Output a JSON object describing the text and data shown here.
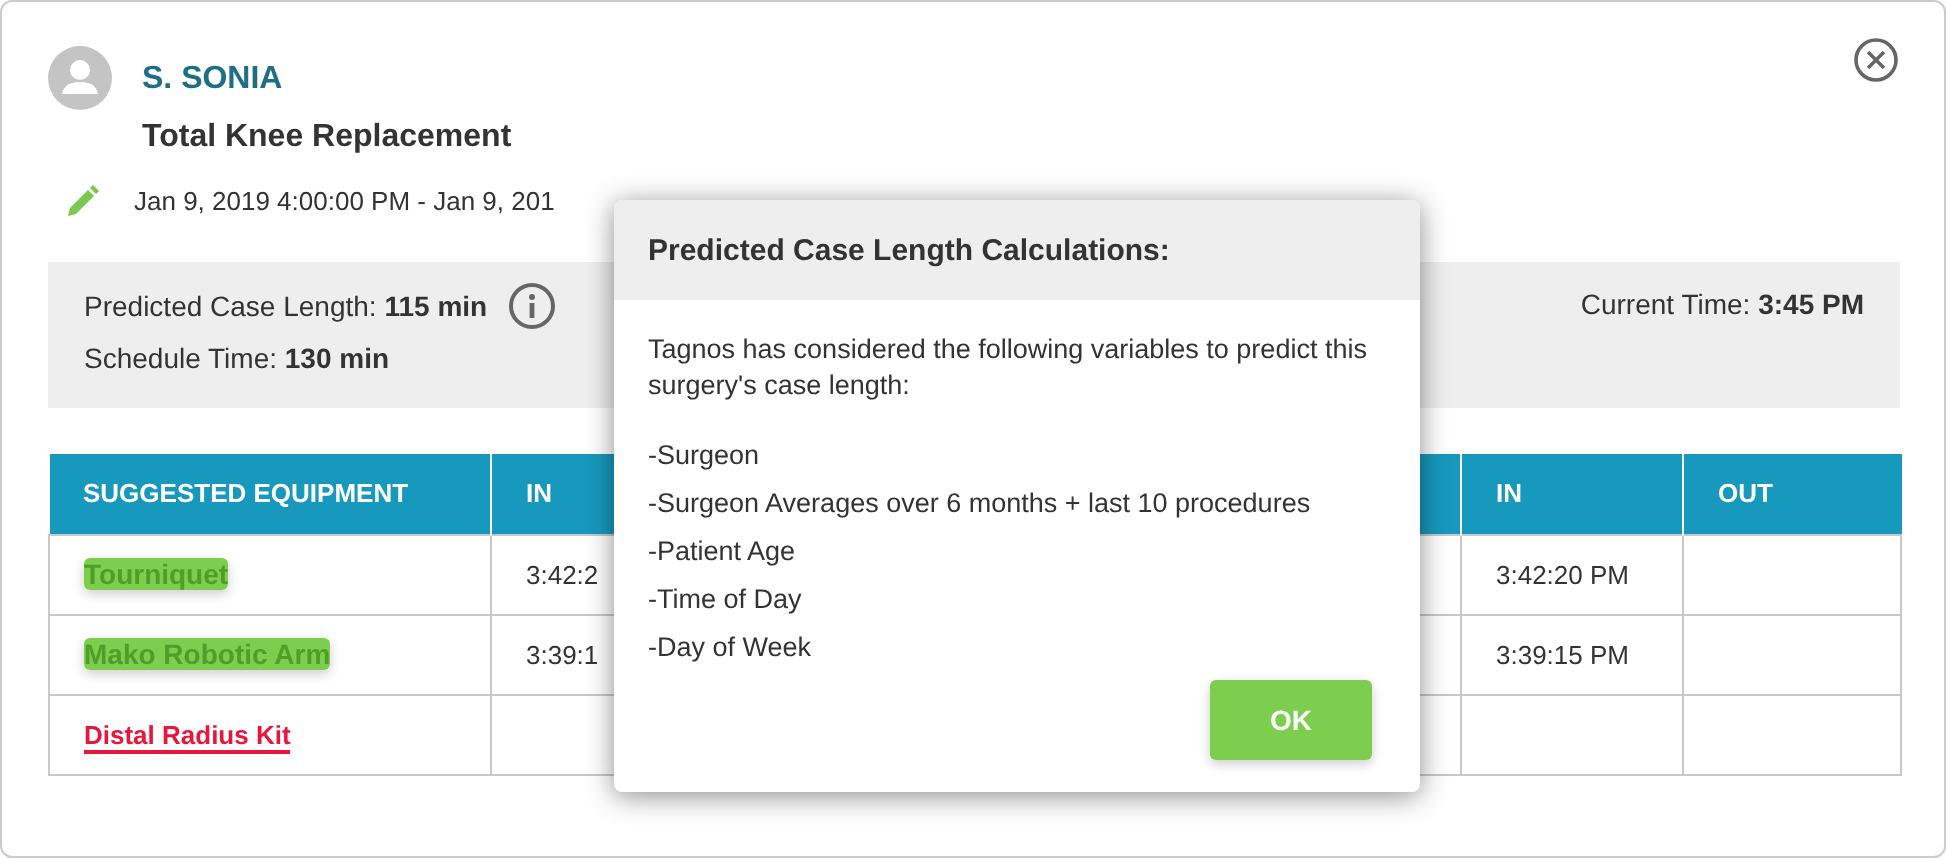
{
  "patient": {
    "name": "S. SONIA",
    "procedure": "Total Knee Replacement",
    "time_range": "Jan 9, 2019 4:00:00 PM - Jan 9, 201"
  },
  "summary": {
    "predicted_label": "Predicted Case Length:",
    "predicted_value": "115 min",
    "schedule_label": "Schedule Time:",
    "schedule_value": "130 min",
    "current_label": "Current Time:",
    "current_value": "3:45 PM"
  },
  "table": {
    "columns": [
      "SUGGESTED EQUIPMENT",
      "IN",
      "IN",
      "OUT"
    ],
    "rows": [
      {
        "name": "Tourniquet",
        "kind": "available",
        "in_1": "3:42:2",
        "in_2": "3:42:20 PM"
      },
      {
        "name": "Mako Robotic Arm",
        "kind": "available",
        "in_1": "3:39:1",
        "in_2": "3:39:15 PM"
      },
      {
        "name": "Distal Radius Kit",
        "kind": "missing"
      }
    ]
  },
  "dialog": {
    "title": "Predicted Case Length Calculations:",
    "intro": "Tagnos has considered the following variables to predict this surgery's case length:",
    "variables": [
      "-Surgeon",
      "-Surgeon Averages over 6 months + last 10 procedures",
      "-Patient Age",
      "-Time of Day",
      "-Day of Week"
    ],
    "button": "OK"
  }
}
